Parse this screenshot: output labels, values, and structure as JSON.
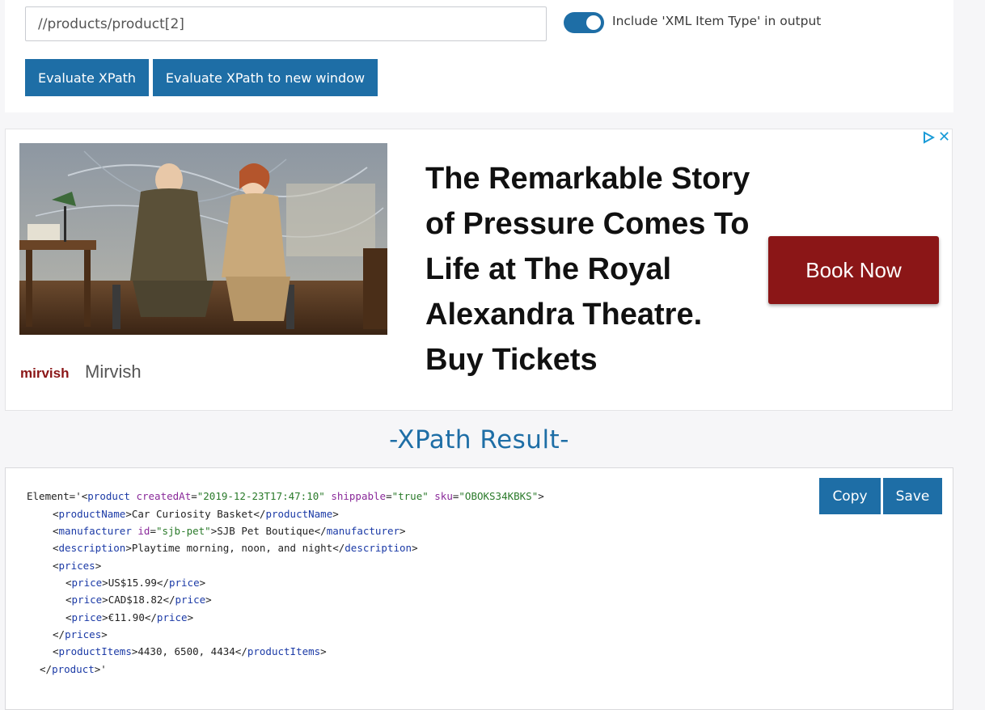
{
  "xpath": {
    "input_value": "//products/product[2]",
    "toggle_label": "Include 'XML Item Type' in output",
    "toggle_on": true,
    "evaluate_label": "Evaluate XPath",
    "evaluate_new_window_label": "Evaluate XPath to new window"
  },
  "ad": {
    "headline": "The Remarkable Story of Pressure Comes To Life at The Royal Alexandra Theatre. Buy Tickets",
    "cta_label": "Book Now",
    "logo_text": "mirvish",
    "brand_name": "Mirvish",
    "close_glyph": "✕"
  },
  "result": {
    "heading": "-XPath Result-",
    "copy_label": "Copy",
    "save_label": "Save",
    "lines": [
      {
        "prefix": "Element='<",
        "tag": "product",
        "attrs": [
          {
            "name": "createdAt",
            "value": "\"2019-12-23T17:47:10\""
          },
          {
            "name": "shippable",
            "value": "\"true\""
          },
          {
            "name": "sku",
            "value": "\"OBOKS34KBKS\""
          }
        ],
        "suffix": ">"
      },
      {
        "open": "productName",
        "text": "Car Curiosity Basket",
        "close": "productName"
      },
      {
        "open": "manufacturer",
        "attr_name": "id",
        "attr_value": "\"sjb-pet\"",
        "text": "SJB Pet Boutique",
        "close": "manufacturer"
      },
      {
        "open": "description",
        "text": "Playtime morning, noon, and night",
        "close": "description"
      },
      {
        "open": "prices"
      },
      {
        "open": "price",
        "text": "US$15.99",
        "close": "price"
      },
      {
        "open": "price",
        "text": "CAD$18.82",
        "close": "price"
      },
      {
        "open": "price",
        "text": "€11.90",
        "close": "price"
      },
      {
        "close": "prices"
      },
      {
        "open": "productItems",
        "text": "4430, 6500, 4434",
        "close": "productItems"
      },
      {
        "close": "product",
        "suffix": "'"
      }
    ]
  },
  "colors": {
    "primary": "#1e6ea6",
    "cta": "#8b1617",
    "tag": "#1b3aa6",
    "attribute": "#8a2a9a",
    "attribute_value": "#2a7a2a"
  }
}
